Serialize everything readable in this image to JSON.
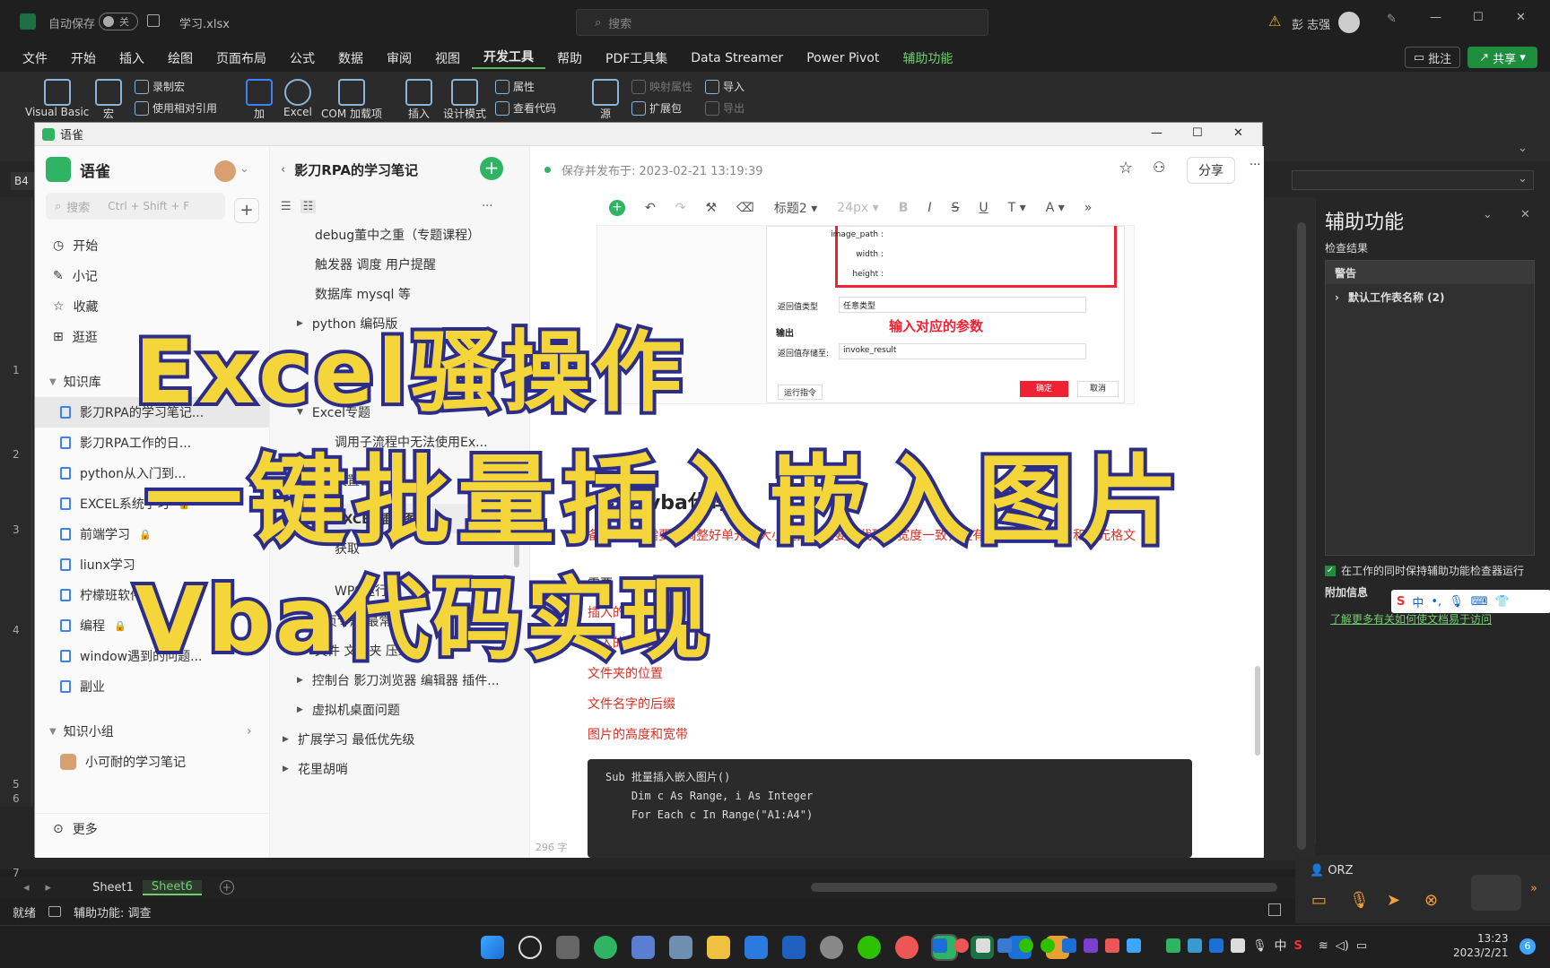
{
  "excel": {
    "autosave_label": "自动保存",
    "autosave_state": "关",
    "filename": "学习.xlsx",
    "search_placeholder": "搜索",
    "user": "彭 志强",
    "menu": [
      "文件",
      "开始",
      "插入",
      "绘图",
      "页面布局",
      "公式",
      "数据",
      "审阅",
      "视图",
      "开发工具",
      "帮助",
      "PDF工具集",
      "Data Streamer",
      "Power Pivot",
      "辅助功能"
    ],
    "comment_btn": "批注",
    "share_btn": "共享",
    "ribbon": {
      "visual_basic": "Visual Basic",
      "macro": "宏",
      "record_macro": "录制宏",
      "relative_ref": "使用相对引用",
      "addin": "加",
      "excel": "Excel",
      "com_addin": "COM 加载项",
      "insert": "插入",
      "design_mode": "设计模式",
      "properties": "属性",
      "view_code": "查看代码",
      "source": "源",
      "map_props": "映射属性",
      "expansion": "扩展包",
      "import": "导入",
      "export": "导出"
    },
    "cell_ref": "B4",
    "row_numbers": [
      "1",
      "2",
      "3",
      "4",
      "5",
      "6",
      "7"
    ],
    "sheets": [
      "Sheet1",
      "Sheet6"
    ],
    "status_ready": "就绪",
    "status_access": "辅助功能: 调查",
    "accessibility": {
      "title": "辅助功能",
      "results": "检查结果",
      "warning": "警告",
      "item": "默认工作表名称 (2)",
      "keep_running": "在工作的同时保持辅助功能检查器运行",
      "extra": "附加信息",
      "link": "了解更多有关如何使文档易于访问"
    },
    "chat_user": "ORZ"
  },
  "yuque": {
    "window_title": "语雀",
    "app_name": "语雀",
    "search_placeholder": "搜索",
    "search_shortcut": "Ctrl + Shift + F",
    "nav": [
      "开始",
      "小记",
      "收藏",
      "逛逛"
    ],
    "kb_header": "知识库",
    "kb": [
      {
        "name": "影刀RPA的学习笔记...",
        "locked": false
      },
      {
        "name": "影刀RPA工作的日...",
        "locked": false
      },
      {
        "name": "python从入门到...",
        "locked": false
      },
      {
        "name": "EXCEL系统学习",
        "locked": true
      },
      {
        "name": "前端学习",
        "locked": true
      },
      {
        "name": "liunx学习",
        "locked": false
      },
      {
        "name": "柠檬班软件...",
        "locked": false
      },
      {
        "name": "编程",
        "locked": true
      },
      {
        "name": "window遇到的问题...",
        "locked": false
      },
      {
        "name": "副业",
        "locked": false
      }
    ],
    "group_header": "知识小组",
    "group_item": "小可耐的学习笔记",
    "more": "更多",
    "book_title": "影刀RPA的学习笔记",
    "toc": [
      {
        "t": "debug董中之重（专题课程）",
        "l": 2
      },
      {
        "t": "触发器 调度 用户提醒",
        "l": 2
      },
      {
        "t": "数据库 mysql 等",
        "l": 2
      },
      {
        "t": "python 编码版",
        "l": 1
      },
      {
        "t": "Excel专题",
        "l": 1
      },
      {
        "t": "调用子流程中无法使用Ex...",
        "l": 3
      },
      {
        "t": "设置密码",
        "l": 3
      },
      {
        "t": "EXCEL插入图片",
        "l": 3,
        "active": true
      },
      {
        "t": "获取",
        "l": 3
      },
      {
        "t": "WPS运行宏",
        "l": 3
      },
      {
        "t": "网页专题 最常见",
        "l": 1
      },
      {
        "t": "文件 文件夹 压缩包",
        "l": 2
      },
      {
        "t": "控制台 影刀浏览器 编辑器 插件...",
        "l": 1
      },
      {
        "t": "虚拟机桌面问题",
        "l": 1
      },
      {
        "t": "扩展学习 最低优先级",
        "l": 0
      },
      {
        "t": "花里胡哨",
        "l": 0
      }
    ],
    "saved": "保存并发布于: 2023-02-21 13:19:39",
    "share": "分享",
    "toolbar": {
      "heading": "标题2",
      "size": "24px"
    },
    "dialog": {
      "image_path": "image_path :",
      "width": "width :",
      "height": "height :",
      "return_type_label": "返回值类型",
      "return_type": "任意类型",
      "output": "输出",
      "hint": "输入对应的参数",
      "save_to_label": "返回值存储至:",
      "save_to": "invoke_result",
      "run": "运行指令",
      "ok": "确定",
      "cancel": "取消"
    },
    "heading": "方法2 vba代码",
    "note": "备注 前提 需要先调整好单元格大小在插入且要和代码中宽度一致，还有就是图片文件名和单元格文",
    "need": "需要",
    "items": [
      "插入的列位置",
      "写入的列位置",
      "文件夹的位置",
      "文件名字的后缀",
      "图片的高度和宽带"
    ],
    "code": [
      "Sub 批量插入嵌入图片()",
      "    Dim c As Range, i As Integer",
      "    For Each c In Range(\"A1:A4\")"
    ],
    "wordcount": "296 字"
  },
  "overlay": {
    "line1": "Excel骚操作",
    "line2": "一键批量插入嵌入图片",
    "line3": "Vba代码实现"
  },
  "taskbar": {
    "time": "13:23",
    "date": "2023/2/21",
    "ime": "中",
    "badge": "6"
  }
}
